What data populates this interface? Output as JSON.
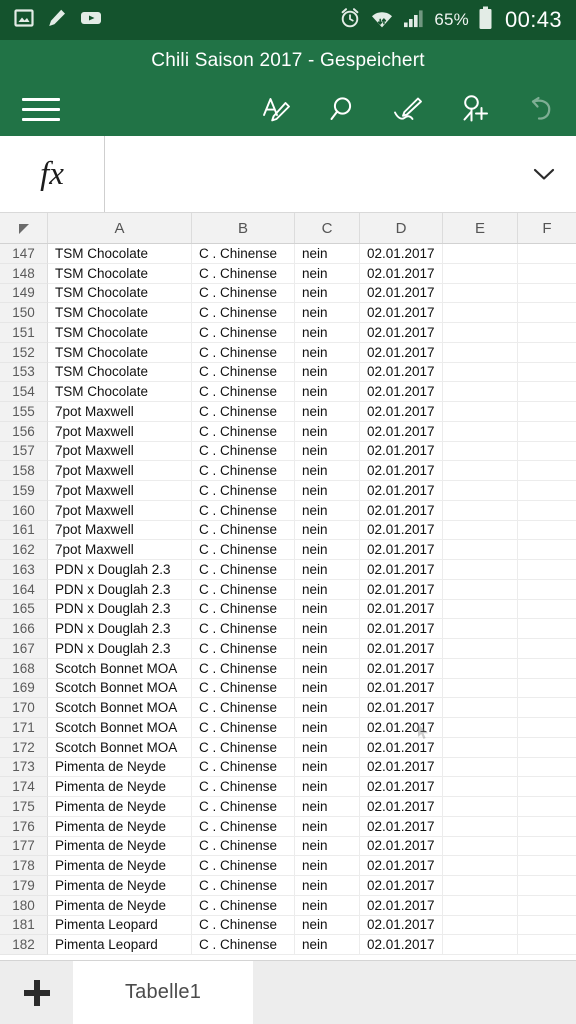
{
  "statusbar": {
    "notifications": [
      {
        "icon": "image-icon",
        "name": "photo-notification"
      },
      {
        "icon": "pencil-icon",
        "name": "edit-notification"
      },
      {
        "icon": "youtube-icon",
        "name": "youtube-notification"
      }
    ],
    "alarm_icon": "alarm-clock-icon",
    "wifi_icon": "wifi-icon",
    "signal_icon": "cellular-signal-icon",
    "battery_percent": "65%",
    "battery_icon": "battery-icon",
    "time": "00:43"
  },
  "titlebar": {
    "document_title": "Chili Saison 2017 - Gespeichert",
    "menu_icon": "hamburger-menu-icon",
    "actions": [
      {
        "name": "edit-button",
        "icon": "edit-pencil-icon",
        "enabled": true
      },
      {
        "name": "search-button",
        "icon": "search-icon",
        "enabled": true
      },
      {
        "name": "draw-button",
        "icon": "ink-pen-icon",
        "enabled": true
      },
      {
        "name": "share-button",
        "icon": "person-add-icon",
        "enabled": true
      },
      {
        "name": "undo-button",
        "icon": "undo-arrow-icon",
        "enabled": false
      }
    ]
  },
  "formula_bar": {
    "fx_label": "fx",
    "value": "",
    "placeholder": "",
    "expand_icon": "chevron-down-icon"
  },
  "grid": {
    "corner_icon": "select-all-triangle-icon",
    "columns": [
      "A",
      "B",
      "C",
      "D",
      "E",
      "F"
    ],
    "rows": [
      {
        "n": "147",
        "A": "TSM Chocolate",
        "B": "C . Chinense",
        "C": "nein",
        "D": "02.01.2017",
        "E": "",
        "F": ""
      },
      {
        "n": "148",
        "A": "TSM Chocolate",
        "B": "C . Chinense",
        "C": "nein",
        "D": "02.01.2017",
        "E": "",
        "F": ""
      },
      {
        "n": "149",
        "A": "TSM Chocolate",
        "B": "C . Chinense",
        "C": "nein",
        "D": "02.01.2017",
        "E": "",
        "F": ""
      },
      {
        "n": "150",
        "A": "TSM Chocolate",
        "B": "C . Chinense",
        "C": "nein",
        "D": "02.01.2017",
        "E": "",
        "F": ""
      },
      {
        "n": "151",
        "A": "TSM Chocolate",
        "B": "C . Chinense",
        "C": "nein",
        "D": "02.01.2017",
        "E": "",
        "F": ""
      },
      {
        "n": "152",
        "A": "TSM Chocolate",
        "B": "C . Chinense",
        "C": "nein",
        "D": "02.01.2017",
        "E": "",
        "F": ""
      },
      {
        "n": "153",
        "A": "TSM Chocolate",
        "B": "C . Chinense",
        "C": "nein",
        "D": "02.01.2017",
        "E": "",
        "F": ""
      },
      {
        "n": "154",
        "A": "TSM Chocolate",
        "B": "C . Chinense",
        "C": "nein",
        "D": "02.01.2017",
        "E": "",
        "F": ""
      },
      {
        "n": "155",
        "A": "7pot Maxwell",
        "B": "C . Chinense",
        "C": "nein",
        "D": "02.01.2017",
        "E": "",
        "F": ""
      },
      {
        "n": "156",
        "A": "7pot Maxwell",
        "B": "C . Chinense",
        "C": "nein",
        "D": "02.01.2017",
        "E": "",
        "F": ""
      },
      {
        "n": "157",
        "A": "7pot Maxwell",
        "B": "C . Chinense",
        "C": "nein",
        "D": "02.01.2017",
        "E": "",
        "F": ""
      },
      {
        "n": "158",
        "A": "7pot Maxwell",
        "B": "C . Chinense",
        "C": "nein",
        "D": "02.01.2017",
        "E": "",
        "F": ""
      },
      {
        "n": "159",
        "A": "7pot Maxwell",
        "B": "C . Chinense",
        "C": "nein",
        "D": "02.01.2017",
        "E": "",
        "F": ""
      },
      {
        "n": "160",
        "A": "7pot Maxwell",
        "B": "C . Chinense",
        "C": "nein",
        "D": "02.01.2017",
        "E": "",
        "F": ""
      },
      {
        "n": "161",
        "A": "7pot Maxwell",
        "B": "C . Chinense",
        "C": "nein",
        "D": "02.01.2017",
        "E": "",
        "F": ""
      },
      {
        "n": "162",
        "A": "7pot Maxwell",
        "B": "C . Chinense",
        "C": "nein",
        "D": "02.01.2017",
        "E": "",
        "F": ""
      },
      {
        "n": "163",
        "A": "PDN x Douglah 2.3",
        "B": "C . Chinense",
        "C": "nein",
        "D": "02.01.2017",
        "E": "",
        "F": ""
      },
      {
        "n": "164",
        "A": "PDN x Douglah 2.3",
        "B": "C . Chinense",
        "C": "nein",
        "D": "02.01.2017",
        "E": "",
        "F": ""
      },
      {
        "n": "165",
        "A": "PDN x Douglah 2.3",
        "B": "C . Chinense",
        "C": "nein",
        "D": "02.01.2017",
        "E": "",
        "F": ""
      },
      {
        "n": "166",
        "A": "PDN x Douglah 2.3",
        "B": "C . Chinense",
        "C": "nein",
        "D": "02.01.2017",
        "E": "",
        "F": ""
      },
      {
        "n": "167",
        "A": "PDN x Douglah 2.3",
        "B": "C . Chinense",
        "C": "nein",
        "D": "02.01.2017",
        "E": "",
        "F": ""
      },
      {
        "n": "168",
        "A": "Scotch Bonnet MOA",
        "B": "C . Chinense",
        "C": "nein",
        "D": "02.01.2017",
        "E": "",
        "F": ""
      },
      {
        "n": "169",
        "A": "Scotch Bonnet MOA",
        "B": "C . Chinense",
        "C": "nein",
        "D": "02.01.2017",
        "E": "",
        "F": ""
      },
      {
        "n": "170",
        "A": "Scotch Bonnet MOA",
        "B": "C . Chinense",
        "C": "nein",
        "D": "02.01.2017",
        "E": "",
        "F": ""
      },
      {
        "n": "171",
        "A": "Scotch Bonnet MOA",
        "B": "C . Chinense",
        "C": "nein",
        "D": "02.01.2017",
        "E": "",
        "F": ""
      },
      {
        "n": "172",
        "A": "Scotch Bonnet MOA",
        "B": "C . Chinense",
        "C": "nein",
        "D": "02.01.2017",
        "E": "",
        "F": ""
      },
      {
        "n": "173",
        "A": "Pimenta de Neyde",
        "B": "C . Chinense",
        "C": "nein",
        "D": "02.01.2017",
        "E": "",
        "F": ""
      },
      {
        "n": "174",
        "A": "Pimenta de Neyde",
        "B": "C . Chinense",
        "C": "nein",
        "D": "02.01.2017",
        "E": "",
        "F": ""
      },
      {
        "n": "175",
        "A": "Pimenta de Neyde",
        "B": "C . Chinense",
        "C": "nein",
        "D": "02.01.2017",
        "E": "",
        "F": ""
      },
      {
        "n": "176",
        "A": "Pimenta de Neyde",
        "B": "C . Chinense",
        "C": "nein",
        "D": "02.01.2017",
        "E": "",
        "F": ""
      },
      {
        "n": "177",
        "A": "Pimenta de Neyde",
        "B": "C . Chinense",
        "C": "nein",
        "D": "02.01.2017",
        "E": "",
        "F": ""
      },
      {
        "n": "178",
        "A": "Pimenta de Neyde",
        "B": "C . Chinense",
        "C": "nein",
        "D": "02.01.2017",
        "E": "",
        "F": ""
      },
      {
        "n": "179",
        "A": "Pimenta de Neyde",
        "B": "C . Chinense",
        "C": "nein",
        "D": "02.01.2017",
        "E": "",
        "F": ""
      },
      {
        "n": "180",
        "A": "Pimenta de Neyde",
        "B": "C . Chinense",
        "C": "nein",
        "D": "02.01.2017",
        "E": "",
        "F": ""
      },
      {
        "n": "181",
        "A": "Pimenta Leopard",
        "B": "C . Chinense",
        "C": "nein",
        "D": "02.01.2017",
        "E": "",
        "F": ""
      },
      {
        "n": "182",
        "A": "Pimenta Leopard",
        "B": "C . Chinense",
        "C": "nein",
        "D": "02.01.2017",
        "E": "",
        "F": ""
      }
    ]
  },
  "sheetbar": {
    "add_icon": "plus-icon",
    "tabs": [
      {
        "label": "Tabelle1",
        "active": true
      }
    ]
  },
  "colors": {
    "status_bar_green": "#14532d",
    "title_bar_green": "#217346",
    "header_grey": "#f2f2f2",
    "sheetbar_grey": "#ededed"
  }
}
